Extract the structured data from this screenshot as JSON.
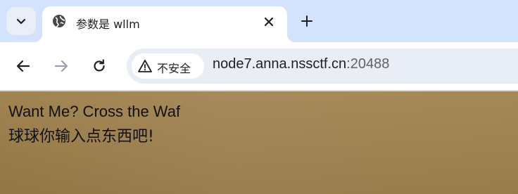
{
  "tab": {
    "title": "参数是 wllm",
    "favicon": "globe-icon"
  },
  "toolbar": {
    "security_label": "不安全",
    "url_host": "node7.anna.nssctf.cn",
    "url_port": ":20488"
  },
  "page": {
    "heading": "Want Me? Cross the Waf",
    "subtext": "球球你输入点东西吧!"
  },
  "colors": {
    "tabstrip": "#d3e3fd",
    "omnibox": "#e9eef6",
    "page_bg": "#a2844f"
  }
}
